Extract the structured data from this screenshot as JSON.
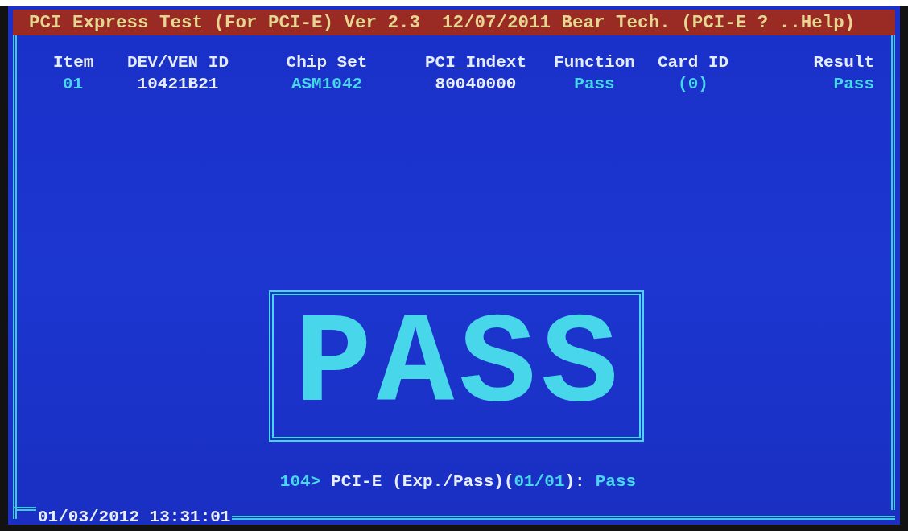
{
  "window": {
    "title": "PCI Express Test (For PCI-E) Ver 2.3  12/07/2011 Bear Tech. (PCI-E ? ..Help)"
  },
  "table": {
    "columns": [
      "Item",
      "DEV/VEN ID",
      "Chip Set",
      "PCI_Indext",
      "Function",
      "Card ID",
      "Result"
    ],
    "rows": [
      {
        "cells": [
          {
            "text": "01",
            "kind": "accent"
          },
          {
            "text": "10421B21",
            "kind": "plain"
          },
          {
            "text": "ASM1042",
            "kind": "accent"
          },
          {
            "text": "80040000",
            "kind": "plain"
          },
          {
            "text": "Pass",
            "kind": "accent"
          },
          {
            "text": "(0)",
            "kind": "accent"
          },
          {
            "text": "Pass",
            "kind": "accent"
          }
        ]
      }
    ]
  },
  "banner": {
    "text": "PASS"
  },
  "status_line": [
    {
      "text": "104>",
      "kind": "accent"
    },
    {
      "text": "PCI-E",
      "kind": "plain"
    },
    {
      "text": "(Exp./Pass)(",
      "kind": "plain"
    },
    {
      "text": "01/01",
      "kind": "accent"
    },
    {
      "text": "):",
      "kind": "plain"
    },
    {
      "text": "Pass",
      "kind": "accent"
    }
  ],
  "status_bar": {
    "datetime": "01/03/2012 13:31:01"
  }
}
